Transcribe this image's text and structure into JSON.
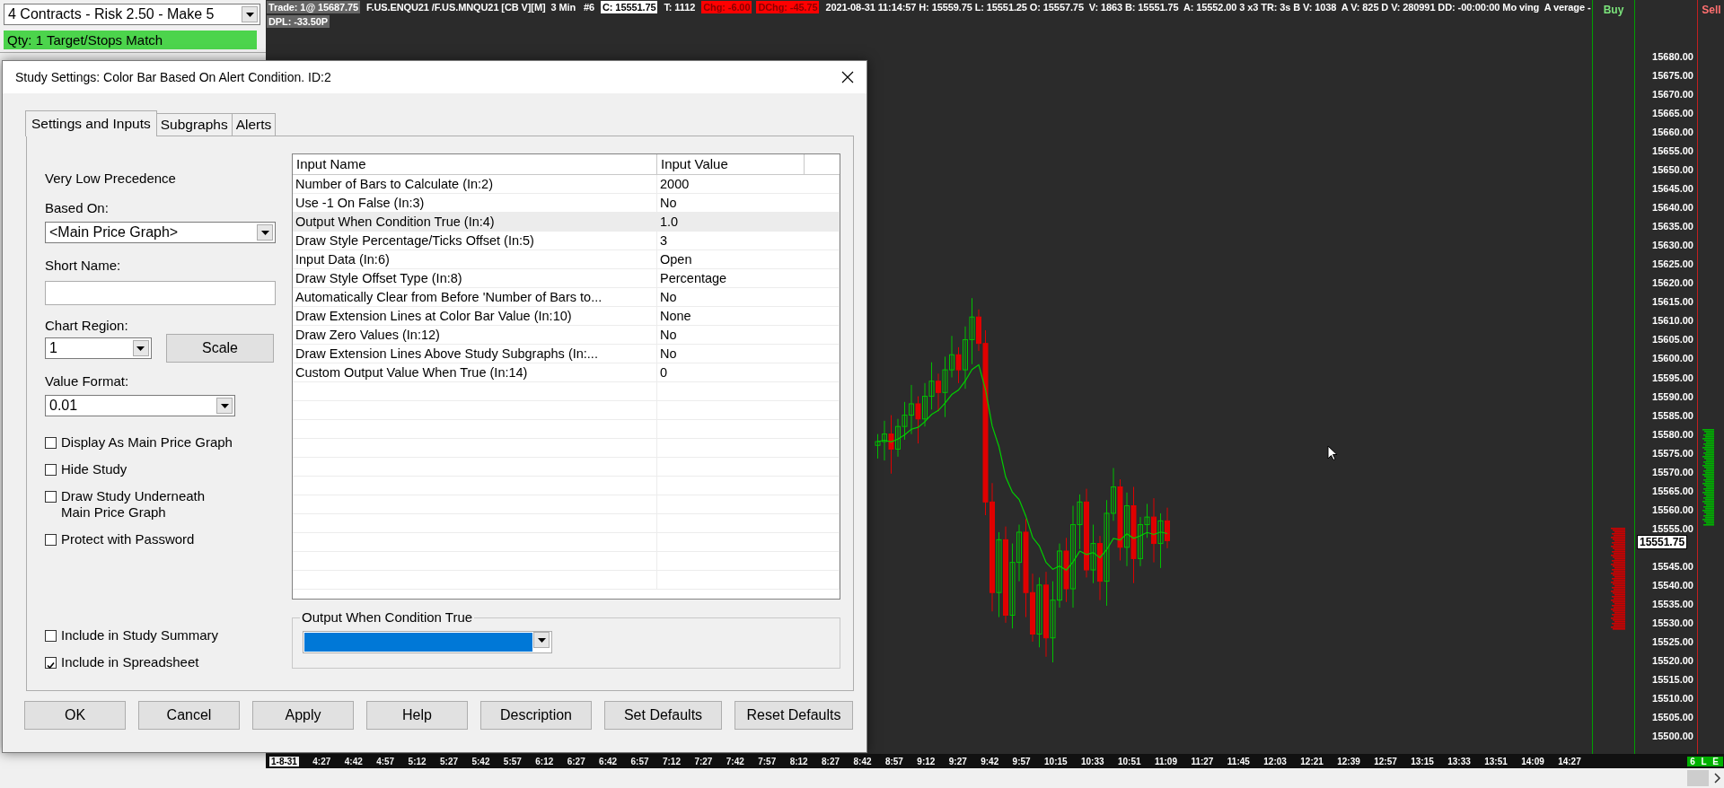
{
  "order_panel": {
    "strategy": "4 Contracts - Risk 2.50 - Make 5",
    "status": "Qty: 1 Target/Stops Match"
  },
  "chart": {
    "header": [
      {
        "text": "Trade: 1@ 15687.75",
        "kind": "grey"
      },
      {
        "text": "F.US.ENQU21 /F.US.MNQU21 [CB V][M]  3 Min   #6",
        "kind": "plain"
      },
      {
        "text": "C: 15551.75",
        "kind": "white"
      },
      {
        "text": "T: 1112",
        "kind": "plain"
      },
      {
        "text": "Chg: -6.00",
        "kind": "red"
      },
      {
        "text": "DChg: -45.75",
        "kind": "red"
      },
      {
        "text": "2021-08-31 11:14:57 H: 15559.75 L: 15551.25 O: 15557.75  V: 1863 B: 15551.75  A: 15552.00 3 x3 TR: 3s B V: 1038  A V: 825 D V: 280991 DD: -00:00:00 Mo ving  A verage -",
        "kind": "plain"
      }
    ],
    "header_line2": [
      {
        "text": "DPL: -33.50P",
        "kind": "grey"
      }
    ],
    "buy_label": "Buy",
    "sell_label": "Sell",
    "price_labels": [
      {
        "text": "15680.00",
        "kind": "tick"
      },
      {
        "text": "15675.00",
        "kind": "tick"
      },
      {
        "text": "15670.00",
        "kind": "tick"
      },
      {
        "text": "15665.00",
        "kind": "tick"
      },
      {
        "text": "15660.00",
        "kind": "tick"
      },
      {
        "text": "15655.00",
        "kind": "tick"
      },
      {
        "text": "15650.00",
        "kind": "tick"
      },
      {
        "text": "15645.00",
        "kind": "tick"
      },
      {
        "text": "15640.00",
        "kind": "tick"
      },
      {
        "text": "15635.00",
        "kind": "tick"
      },
      {
        "text": "15630.00",
        "kind": "tick"
      },
      {
        "text": "15625.00",
        "kind": "tick"
      },
      {
        "text": "15620.00",
        "kind": "tick"
      },
      {
        "text": "15615.00",
        "kind": "tick"
      },
      {
        "text": "15610.00",
        "kind": "tick"
      },
      {
        "text": "15605.00",
        "kind": "tick"
      },
      {
        "text": "15600.00",
        "kind": "tick"
      },
      {
        "text": "15595.00",
        "kind": "tick"
      },
      {
        "text": "15590.00",
        "kind": "tick"
      },
      {
        "text": "15585.00",
        "kind": "tick"
      },
      {
        "text": "15580.00",
        "kind": "tick"
      },
      {
        "text": "15575.00",
        "kind": "tick"
      },
      {
        "text": "15570.00",
        "kind": "tick"
      },
      {
        "text": "15565.00",
        "kind": "tick"
      },
      {
        "text": "15560.00",
        "kind": "tick"
      },
      {
        "text": "15555.00",
        "kind": "tick"
      },
      {
        "text": "15551.75",
        "kind": "last"
      },
      {
        "text": "15545.00",
        "kind": "tick"
      },
      {
        "text": "15540.00",
        "kind": "tick"
      },
      {
        "text": "15535.00",
        "kind": "tick"
      },
      {
        "text": "15530.00",
        "kind": "tick"
      },
      {
        "text": "15525.00",
        "kind": "tick"
      },
      {
        "text": "15520.00",
        "kind": "tick"
      },
      {
        "text": "15515.00",
        "kind": "tick"
      },
      {
        "text": "15510.00",
        "kind": "tick"
      },
      {
        "text": "15505.00",
        "kind": "tick"
      },
      {
        "text": "15500.00",
        "kind": "tick"
      }
    ],
    "time_labels": [
      {
        "text": "1-8-31",
        "kind": "date"
      },
      {
        "text": "4:27",
        "kind": "time"
      },
      {
        "text": "4:42",
        "kind": "time"
      },
      {
        "text": "4:57",
        "kind": "time"
      },
      {
        "text": "5:12",
        "kind": "time"
      },
      {
        "text": "5:27",
        "kind": "time"
      },
      {
        "text": "5:42",
        "kind": "time"
      },
      {
        "text": "5:57",
        "kind": "time"
      },
      {
        "text": "6:12",
        "kind": "time"
      },
      {
        "text": "6:27",
        "kind": "time"
      },
      {
        "text": "6:42",
        "kind": "time"
      },
      {
        "text": "6:57",
        "kind": "time"
      },
      {
        "text": "7:12",
        "kind": "time"
      },
      {
        "text": "7:27",
        "kind": "time"
      },
      {
        "text": "7:42",
        "kind": "time"
      },
      {
        "text": "7:57",
        "kind": "time"
      },
      {
        "text": "8:12",
        "kind": "time"
      },
      {
        "text": "8:27",
        "kind": "time"
      },
      {
        "text": "8:42",
        "kind": "time"
      },
      {
        "text": "8:57",
        "kind": "time"
      },
      {
        "text": "9:12",
        "kind": "time"
      },
      {
        "text": "9:27",
        "kind": "time"
      },
      {
        "text": "9:42",
        "kind": "time"
      },
      {
        "text": "9:57",
        "kind": "time"
      },
      {
        "text": "10:15",
        "kind": "time"
      },
      {
        "text": "10:33",
        "kind": "time"
      },
      {
        "text": "10:51",
        "kind": "time"
      },
      {
        "text": "11:09",
        "kind": "time"
      },
      {
        "text": "11:27",
        "kind": "time"
      },
      {
        "text": "11:45",
        "kind": "time"
      },
      {
        "text": "12:03",
        "kind": "time"
      },
      {
        "text": "12:21",
        "kind": "time"
      },
      {
        "text": "12:39",
        "kind": "time"
      },
      {
        "text": "12:57",
        "kind": "time"
      },
      {
        "text": "13:15",
        "kind": "time"
      },
      {
        "text": "13:33",
        "kind": "time"
      },
      {
        "text": "13:51",
        "kind": "time"
      },
      {
        "text": "14:09",
        "kind": "time"
      },
      {
        "text": "14:27",
        "kind": "time"
      }
    ],
    "status_badge": "6 L E"
  },
  "dialog": {
    "title": "Study Settings: Color Bar Based On Alert Condition. ID:2",
    "tabs": [
      {
        "label": "Settings and Inputs",
        "selected": true
      },
      {
        "label": "Subgraphs",
        "selected": false
      },
      {
        "label": "Alerts",
        "selected": false
      }
    ],
    "precedence": "Very Low Precedence",
    "based_on": {
      "label": "Based On:",
      "value": "<Main Price Graph>"
    },
    "short_name": {
      "label": "Short Name:"
    },
    "chart_region": {
      "label": "Chart Region:",
      "value": "1"
    },
    "scale_button": "Scale",
    "value_format": {
      "label": "Value Format:",
      "value": "0.01"
    },
    "options": [
      {
        "label": "Display As Main Price Graph",
        "checked": false
      },
      {
        "label": "Hide Study",
        "checked": false
      },
      {
        "label": "Draw Study Underneath\nMain Price Graph",
        "checked": false
      },
      {
        "label": "Protect with Password",
        "checked": false
      }
    ],
    "bottom_options": [
      {
        "label": "Include in Study Summary",
        "checked": false
      },
      {
        "label": "Include in Spreadsheet",
        "checked": true
      }
    ],
    "table": {
      "columns": [
        "Input Name",
        "Input Value"
      ],
      "rows": [
        {
          "name": "Number of Bars to Calculate   (In:2)",
          "value": "2000",
          "selected": false
        },
        {
          "name": "Use -1 On False   (In:3)",
          "value": "No",
          "selected": false
        },
        {
          "name": "Output When Condition True   (In:4)",
          "value": "1.0",
          "selected": true
        },
        {
          "name": "Draw Style Percentage/Ticks Offset   (In:5)",
          "value": "3",
          "selected": false
        },
        {
          "name": "Input Data   (In:6)",
          "value": "Open",
          "selected": false
        },
        {
          "name": "Draw Style Offset Type   (In:8)",
          "value": "Percentage",
          "selected": false
        },
        {
          "name": "Automatically Clear from Before 'Number of Bars to...",
          "value": "No",
          "selected": false
        },
        {
          "name": "Draw Extension Lines at Color Bar Value   (In:10)",
          "value": "None",
          "selected": false
        },
        {
          "name": "Draw Zero Values   (In:12)",
          "value": "No",
          "selected": false
        },
        {
          "name": "Draw Extension Lines Above Study Subgraphs   (In:...",
          "value": "No",
          "selected": false
        },
        {
          "name": "Custom Output Value When True   (In:14)",
          "value": "0",
          "selected": false
        }
      ]
    },
    "output_group": {
      "label": "Output When Condition True",
      "color": "#0078d7"
    },
    "buttons": [
      "OK",
      "Cancel",
      "Apply",
      "Help",
      "Description",
      "Set Defaults",
      "Reset Defaults"
    ]
  }
}
